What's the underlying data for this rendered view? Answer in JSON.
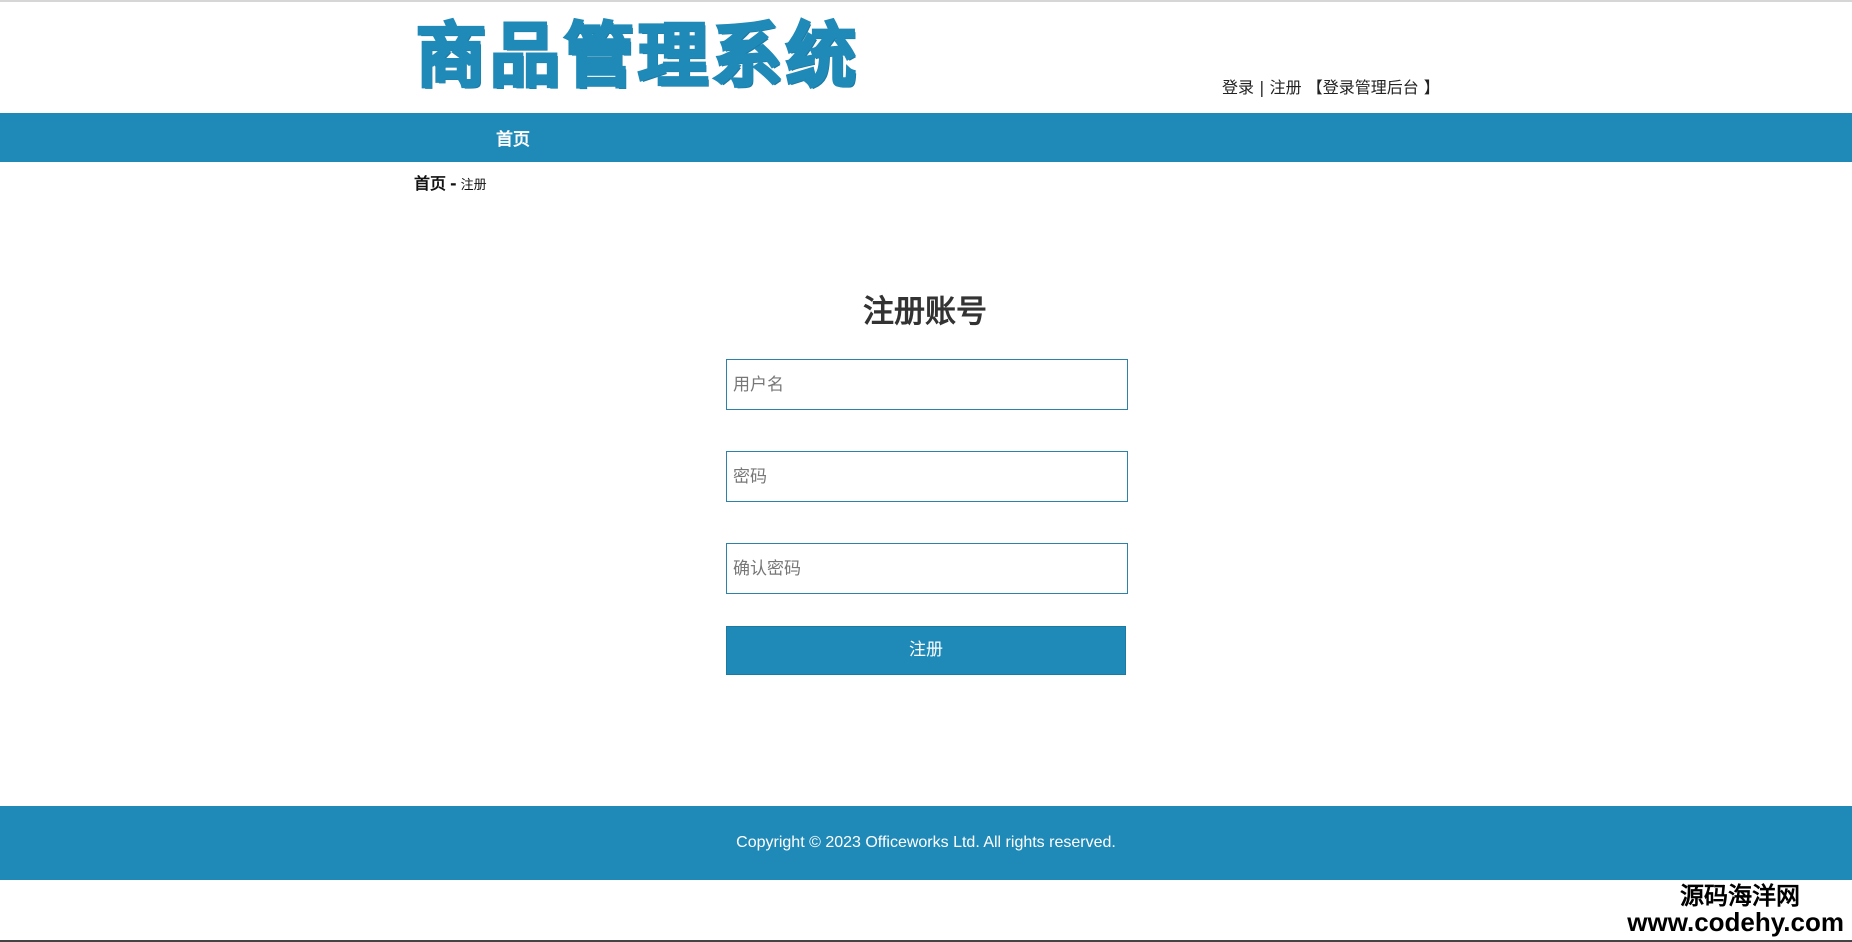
{
  "header": {
    "logo_text": "商品管理系统",
    "links": {
      "login": "登录",
      "separator": "|",
      "register": "注册",
      "admin": "【登录管理后台 】"
    }
  },
  "navbar": {
    "home_label": "首页"
  },
  "breadcrumb": {
    "home": "首页",
    "separator": "-",
    "current": "注册"
  },
  "form": {
    "title": "注册账号",
    "username_placeholder": "用户名",
    "password_placeholder": "密码",
    "confirm_placeholder": "确认密码",
    "submit_label": "注册"
  },
  "footer": {
    "copyright": "Copyright © 2023 Officeworks Ltd. All rights reserved."
  },
  "watermark": {
    "site_name": "源码海洋网",
    "url": "www.codehy.com"
  },
  "colors": {
    "primary": "#1f8ab8",
    "field_border": "#2c82a8"
  }
}
